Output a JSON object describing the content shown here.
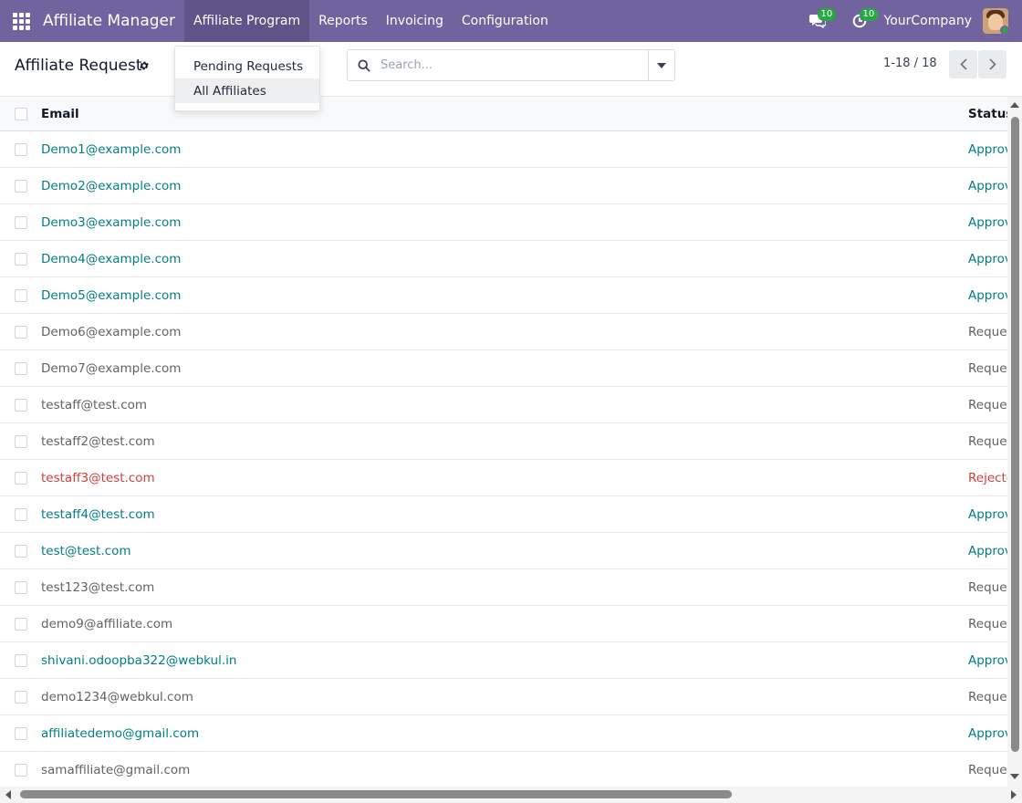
{
  "navbar": {
    "app_name": "Affiliate Manager",
    "menus": [
      "Affiliate Program",
      "Reports",
      "Invoicing",
      "Configuration"
    ],
    "messages_badge": "10",
    "activities_badge": "10",
    "company": "YourCompany"
  },
  "dropdown": {
    "items": [
      "Pending Requests",
      "All Affiliates"
    ]
  },
  "control": {
    "title": "Affiliate Request",
    "search_placeholder": "Search...",
    "pager": "1-18 / 18"
  },
  "list": {
    "columns": {
      "email": "Email",
      "status": "Status"
    },
    "rows": [
      {
        "email": "Demo1@example.com",
        "status": "Approved",
        "color": "#017e84"
      },
      {
        "email": "Demo2@example.com",
        "status": "Approved",
        "color": "#017e84"
      },
      {
        "email": "Demo3@example.com",
        "status": "Approved",
        "color": "#017e84"
      },
      {
        "email": "Demo4@example.com",
        "status": "Approved",
        "color": "#017e84"
      },
      {
        "email": "Demo5@example.com",
        "status": "Approved",
        "color": "#017e84"
      },
      {
        "email": "Demo6@example.com",
        "status": "Requested",
        "color": "#5f6368"
      },
      {
        "email": "Demo7@example.com",
        "status": "Requested",
        "color": "#5f6368"
      },
      {
        "email": "testaff@test.com",
        "status": "Requested",
        "color": "#5f6368"
      },
      {
        "email": "testaff2@test.com",
        "status": "Requested",
        "color": "#5f6368"
      },
      {
        "email": "testaff3@test.com",
        "status": "Rejected",
        "color": "#d23f3a"
      },
      {
        "email": "testaff4@test.com",
        "status": "Approved",
        "color": "#017e84"
      },
      {
        "email": "test@test.com",
        "status": "Approved",
        "color": "#017e84"
      },
      {
        "email": "test123@test.com",
        "status": "Requested",
        "color": "#5f6368"
      },
      {
        "email": "demo9@affiliate.com",
        "status": "Requested",
        "color": "#5f6368"
      },
      {
        "email": "shivani.odoopba322@webkul.in",
        "status": "Approved",
        "color": "#017e84"
      },
      {
        "email": "demo1234@webkul.com",
        "status": "Requested",
        "color": "#5f6368"
      },
      {
        "email": "affiliatedemo@gmail.com",
        "status": "Approved",
        "color": "#017e84"
      },
      {
        "email": "samaffiliate@gmail.com",
        "status": "Requested",
        "color": "#5f6368"
      }
    ]
  },
  "colors": {
    "navbar": "#71639e",
    "approved": "#017e84",
    "requested": "#5f6368",
    "rejected": "#d23f3a",
    "badge": "#28a745"
  }
}
